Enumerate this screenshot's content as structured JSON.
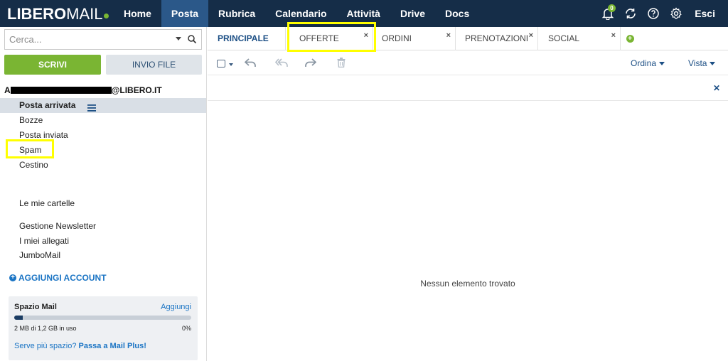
{
  "logo": {
    "main": "LIBERO",
    "sub": "MAIL"
  },
  "nav": {
    "items": [
      {
        "label": "Home"
      },
      {
        "label": "Posta"
      },
      {
        "label": "Rubrica"
      },
      {
        "label": "Calendario"
      },
      {
        "label": "Attività"
      },
      {
        "label": "Drive"
      },
      {
        "label": "Docs"
      }
    ],
    "active": "Posta",
    "notification_count": "0",
    "logout": "Esci"
  },
  "search": {
    "placeholder": "Cerca..."
  },
  "buttons": {
    "compose": "SCRIVI",
    "send_file": "INVIO FILE"
  },
  "account": {
    "prefix": "A",
    "suffix": "@LIBERO.IT"
  },
  "folders": [
    {
      "label": "Posta arrivata"
    },
    {
      "label": "Bozze"
    },
    {
      "label": "Posta inviata"
    },
    {
      "label": "Spam"
    },
    {
      "label": "Cestino"
    }
  ],
  "my_folders": "Le mie cartelle",
  "extras": [
    {
      "label": "Gestione Newsletter"
    },
    {
      "label": "I miei allegati"
    },
    {
      "label": "JumboMail"
    }
  ],
  "add_account": "AGGIUNGI ACCOUNT",
  "storage": {
    "title": "Spazio Mail",
    "add": "Aggiungi",
    "used": "2 MB di 1,2 GB in uso",
    "percent": "0%",
    "bar_fill_fraction": 0.05,
    "promo_prefix": "Serve più spazio?",
    "promo_link": "Passa a Mail Plus!"
  },
  "tabs": [
    {
      "label": "PRINCIPALE"
    },
    {
      "label": "OFFERTE"
    },
    {
      "label": "ORDINI"
    },
    {
      "label": "PRENOTAZIONI"
    },
    {
      "label": "SOCIAL"
    }
  ],
  "toolbar": {
    "sort": "Ordina",
    "view": "Vista"
  },
  "empty_message": "Nessun elemento trovato",
  "colors": {
    "topbar": "#152d48",
    "active_nav": "#2b5889",
    "accent_green": "#7ab533",
    "link_blue": "#1a74c4",
    "highlight": "#ffff00"
  }
}
